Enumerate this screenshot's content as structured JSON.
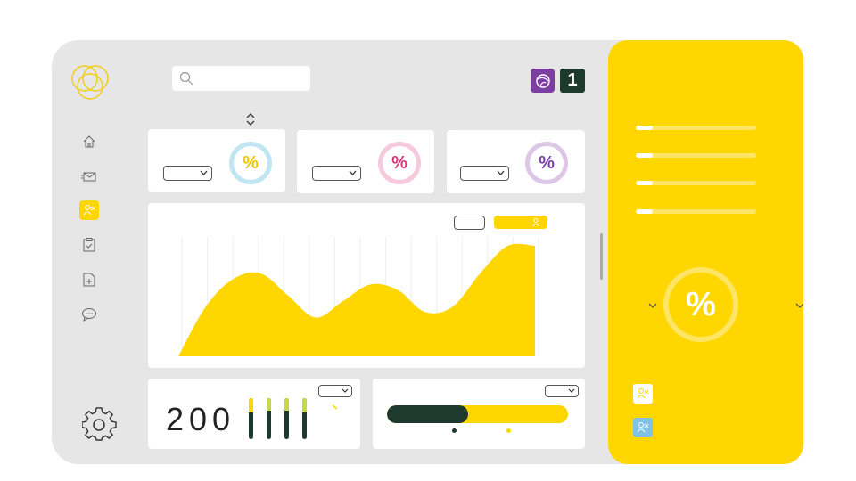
{
  "search": {
    "placeholder": ""
  },
  "header": {
    "notification_count": "1"
  },
  "stat_cards": [
    {
      "symbol": "%",
      "ring_color": "#bfe6f2",
      "text_color": "#f0c400"
    },
    {
      "symbol": "%",
      "ring_color": "#f7c9dc",
      "text_color": "#d63a7a"
    },
    {
      "symbol": "%",
      "ring_color": "#ddc7e6",
      "text_color": "#7b3fa0"
    }
  ],
  "chart_data": {
    "type": "area",
    "x": [
      0,
      1,
      2,
      3,
      4,
      5,
      6,
      7,
      8,
      9,
      10,
      11,
      12,
      13
    ],
    "series": [
      {
        "values": [
          0,
          45,
          70,
          75,
          55,
          35,
          50,
          65,
          60,
          40,
          45,
          75,
          100,
          100
        ],
        "color": "#ffd600"
      }
    ],
    "grid": "vertical"
  },
  "counter": {
    "value": "200"
  },
  "bars": [
    {
      "level": 0.35,
      "color": "#ffd600"
    },
    {
      "level": 0.3,
      "color": "#c6d84a"
    },
    {
      "level": 0.3,
      "color": "#c6d84a"
    },
    {
      "level": 0.35,
      "color": "#c6d84a"
    }
  ],
  "progress": {
    "fraction": 0.45,
    "fill_color": "#1e3a2e",
    "track_color": "#ffd600"
  },
  "right_panel": {
    "items": [
      {
        "fraction": 0.14
      },
      {
        "fraction": 0.14
      },
      {
        "fraction": 0.14
      },
      {
        "fraction": 0.14
      }
    ],
    "gauge_symbol": "%"
  },
  "colors": {
    "accent": "#ffd600",
    "dark": "#1e3a2e",
    "purple": "#7b3fa0"
  }
}
